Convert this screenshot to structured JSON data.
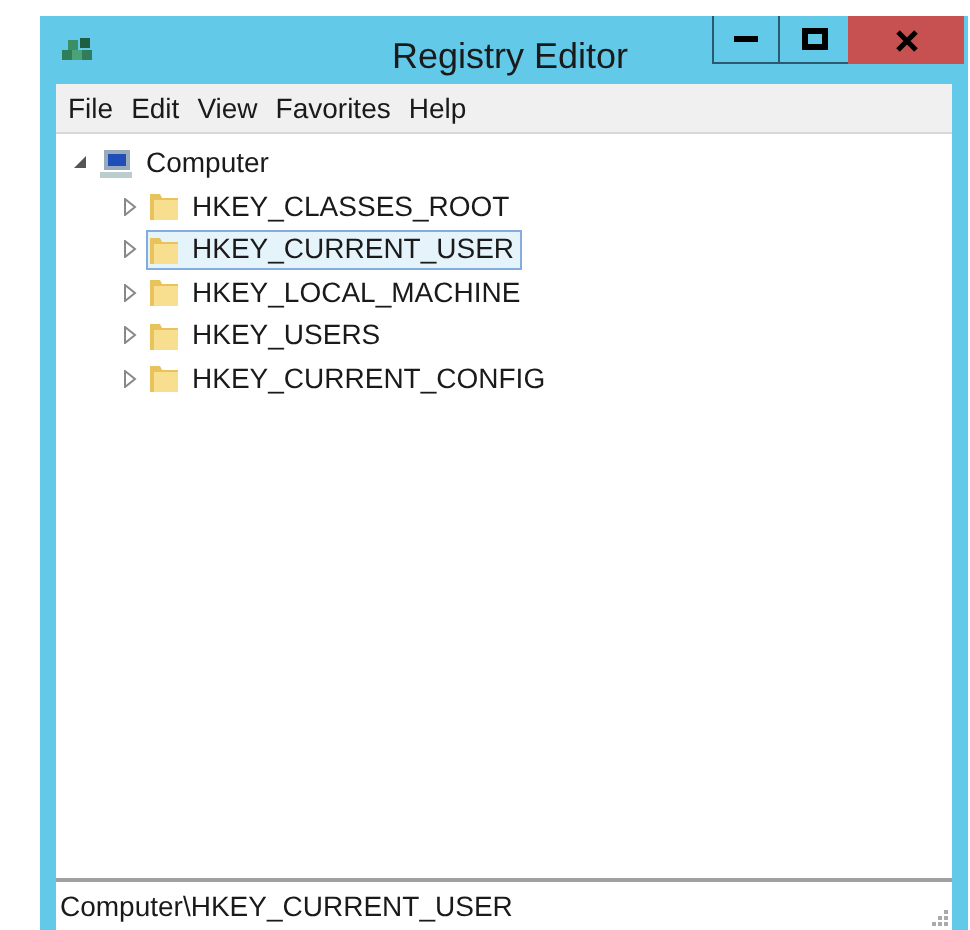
{
  "window": {
    "title": "Registry Editor"
  },
  "menu": [
    "File",
    "Edit",
    "View",
    "Favorites",
    "Help"
  ],
  "tree": {
    "label": "Computer",
    "expanded": true,
    "children": [
      {
        "label": "HKEY_CLASSES_ROOT",
        "expanded": false,
        "selected": false
      },
      {
        "label": "HKEY_CURRENT_USER",
        "expanded": false,
        "selected": true
      },
      {
        "label": "HKEY_LOCAL_MACHINE",
        "expanded": false,
        "selected": false
      },
      {
        "label": "HKEY_USERS",
        "expanded": false,
        "selected": false
      },
      {
        "label": "HKEY_CURRENT_CONFIG",
        "expanded": false,
        "selected": false
      }
    ]
  },
  "status_bar": "Computer\\HKEY_CURRENT_USER"
}
